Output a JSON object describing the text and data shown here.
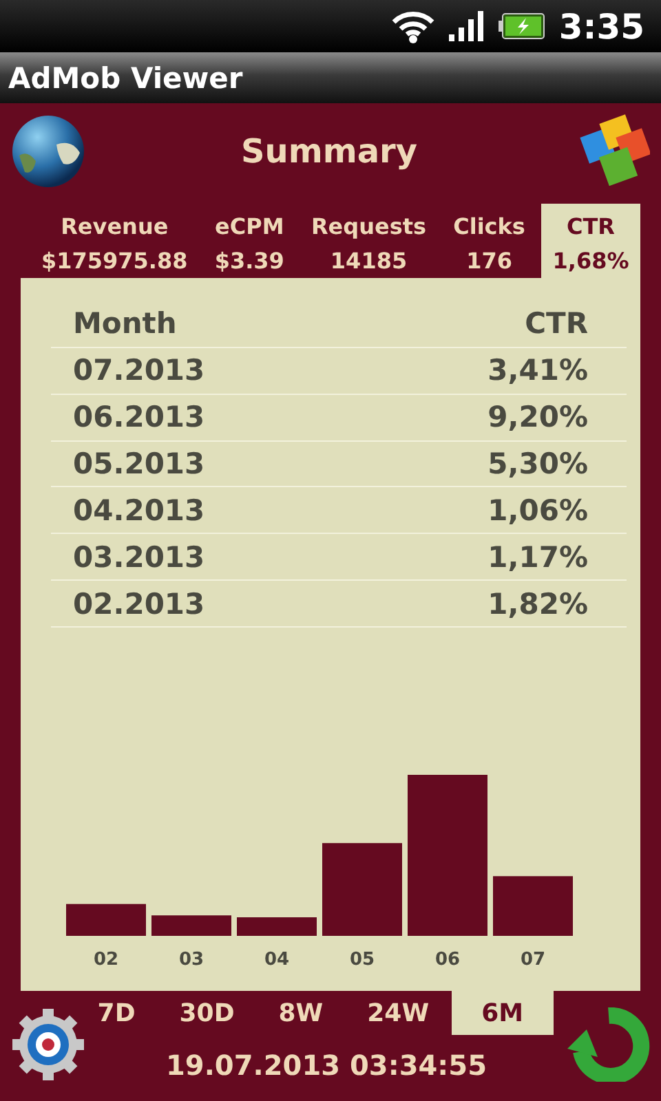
{
  "status_bar": {
    "time": "3:35"
  },
  "window": {
    "title": "AdMob Viewer"
  },
  "header": {
    "title": "Summary"
  },
  "metrics": [
    {
      "label": "Revenue",
      "value": "$175975.88",
      "selected": false
    },
    {
      "label": "eCPM",
      "value": "$3.39",
      "selected": false
    },
    {
      "label": "Requests",
      "value": "14185",
      "selected": false
    },
    {
      "label": "Clicks",
      "value": "176",
      "selected": false
    },
    {
      "label": "CTR",
      "value": "1,68%",
      "selected": true
    }
  ],
  "table": {
    "columns": [
      "Month",
      "CTR"
    ],
    "rows": [
      [
        "07.2013",
        "3,41%"
      ],
      [
        "06.2013",
        "9,20%"
      ],
      [
        "05.2013",
        "5,30%"
      ],
      [
        "04.2013",
        "1,06%"
      ],
      [
        "03.2013",
        "1,17%"
      ],
      [
        "02.2013",
        "1,82%"
      ]
    ]
  },
  "chart": {
    "labels": [
      "02",
      "03",
      "04",
      "05",
      "06",
      "07"
    ]
  },
  "periods": [
    {
      "label": "7D",
      "selected": false
    },
    {
      "label": "30D",
      "selected": false
    },
    {
      "label": "8W",
      "selected": false
    },
    {
      "label": "24W",
      "selected": false
    },
    {
      "label": "6M",
      "selected": true
    }
  ],
  "footer": {
    "updated": "19.07.2013 03:34:55"
  }
}
